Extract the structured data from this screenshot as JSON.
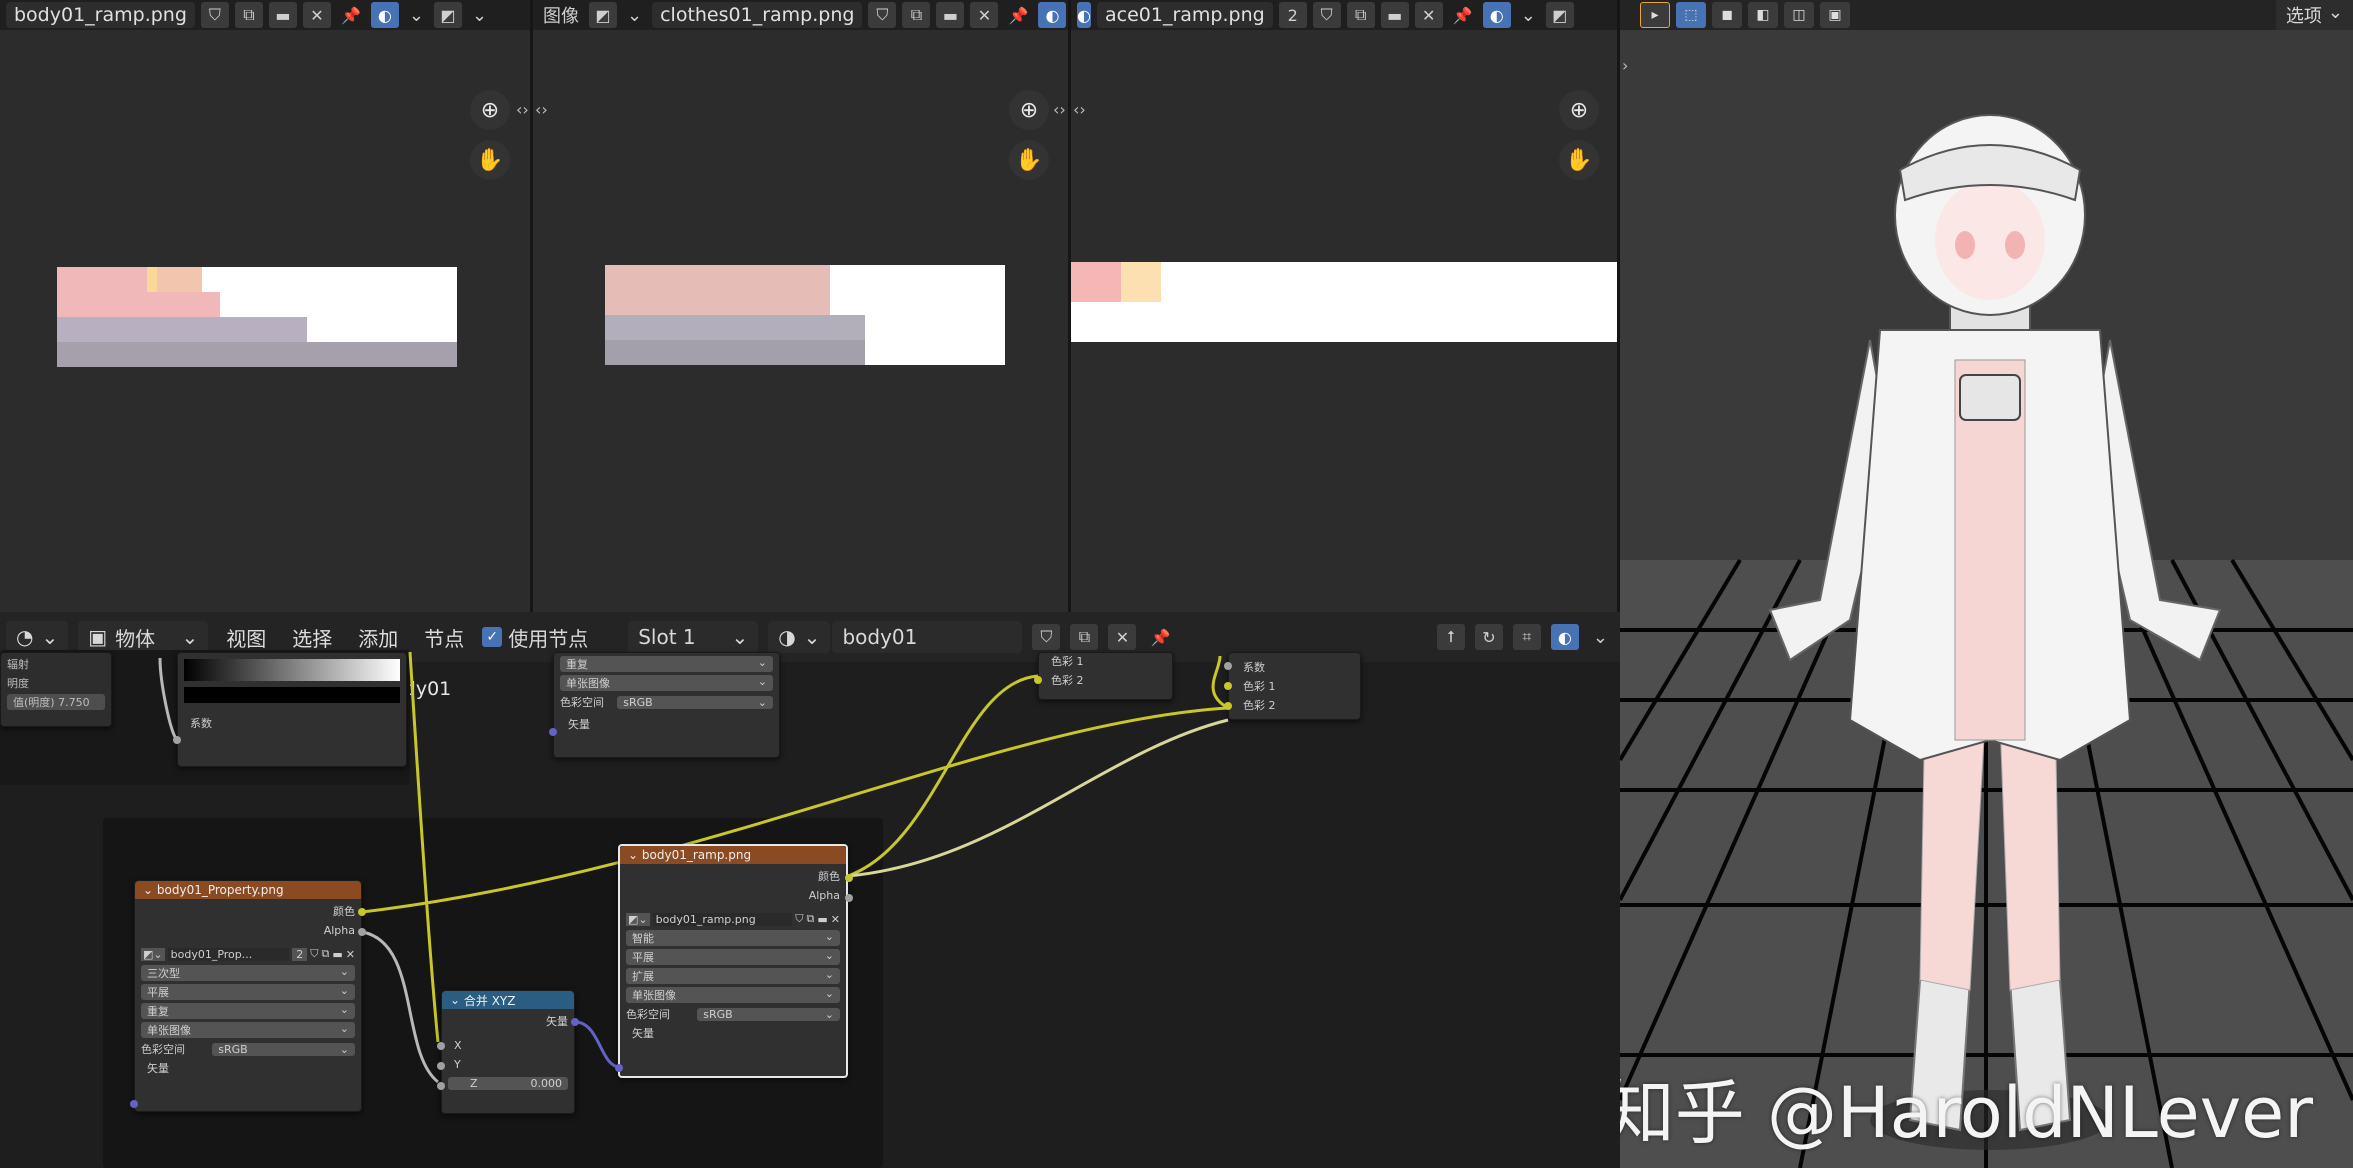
{
  "image_editors": [
    {
      "image_name": "body01_ramp.png",
      "ramp": [
        {
          "color": "#f0b8b8"
        },
        {
          "color": "#f2c6ae"
        },
        {
          "color": "#fcd79a"
        },
        {
          "color": "#b8b0c0"
        },
        {
          "color": "#a6a0ac"
        }
      ]
    },
    {
      "prefix": "图像",
      "image_name": "clothes01_ramp.png",
      "ramp": [
        {
          "color": "#e6bcb6"
        },
        {
          "color": "#b2aeba"
        },
        {
          "color": "#a4a0aa"
        }
      ]
    },
    {
      "image_name": "ace01_ramp.png",
      "users": "2",
      "ramp": [
        {
          "color": "#f4b7b6"
        },
        {
          "color": "#fde0b2"
        }
      ]
    }
  ],
  "node_editor": {
    "editor_type_icon": "shader-editor-icon",
    "object_type": "物体",
    "menu": [
      "视图",
      "选择",
      "添加",
      "节点"
    ],
    "use_nodes_label": "使用节点",
    "slot": "Slot 1",
    "material": "body01",
    "breadcrumb": [
      "body01",
      "body01",
      "body01"
    ],
    "nodes": {
      "top_left_partial": {
        "rows": [
          "辐射",
          "明度",
          "值(明度)  7.750"
        ]
      },
      "color_ramp_partial": {
        "input": "系数"
      },
      "image_top_partial": {
        "rows": [
          "重复",
          "单张图像"
        ],
        "colorspace_label": "色彩空间",
        "colorspace": "sRGB",
        "vector": "矢量"
      },
      "mix_top_partial": {
        "rows": [
          "色彩 1",
          "色彩 2"
        ]
      },
      "mix_right_partial": {
        "rows": [
          "系数",
          "色彩 1",
          "色彩 2"
        ]
      },
      "property_image": {
        "title": "body01_Property.png",
        "out_color": "颜色",
        "out_alpha": "Alpha",
        "image": "body01_Prop...",
        "users": "2",
        "options": [
          "三次型",
          "平展",
          "重复",
          "单张图像"
        ],
        "colorspace_label": "色彩空间",
        "colorspace": "sRGB",
        "vector": "矢量"
      },
      "combine_xyz": {
        "title": "合并 XYZ",
        "out": "矢量",
        "x": "X",
        "y": "Y",
        "z_label": "Z",
        "z_value": "0.000"
      },
      "ramp_image": {
        "title": "body01_ramp.png",
        "out_color": "颜色",
        "out_alpha": "Alpha",
        "image": "body01_ramp.png",
        "options": [
          "智能",
          "平展",
          "扩展",
          "单张图像"
        ],
        "colorspace_label": "色彩空间",
        "colorspace": "sRGB",
        "vector": "矢量"
      }
    }
  },
  "viewport": {
    "options_label": "选项",
    "watermark": "知乎 @HaroldNLever"
  },
  "colors": {
    "image_node_header": "#8a4a22",
    "vector_node_header": "#2a5d82",
    "color_socket": "#c7c729",
    "gray_socket": "#a1a1a1",
    "vector_socket": "#6363c7",
    "accent": "#4772b3"
  }
}
